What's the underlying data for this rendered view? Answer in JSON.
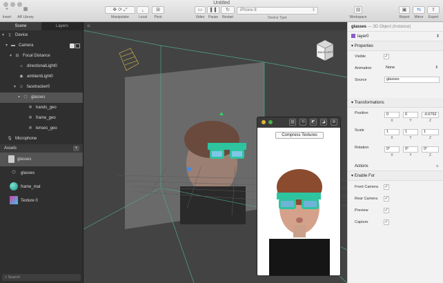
{
  "window": {
    "title": "Untitled"
  },
  "toolbar": {
    "insert": "Insert",
    "all_library": "AR Library",
    "manipulator": "Manipulator",
    "local": "Local",
    "pivot": "Pivot",
    "video": "Video",
    "pause": "Pause",
    "restart": "Restart",
    "device_value": "iPhone 8",
    "device_label": "Device Type",
    "workspace": "Workspace",
    "report": "Report",
    "mirror": "Mirror",
    "export": "Export"
  },
  "scene_panel": {
    "tabs": [
      "Scene",
      "Layers"
    ],
    "items": [
      {
        "label": "Device",
        "icon": "device-icon"
      },
      {
        "label": "Camera",
        "icon": "camera-icon"
      },
      {
        "label": "Focal Distance",
        "icon": "focal-distance-icon"
      },
      {
        "label": "directionalLight0",
        "icon": "light-icon"
      },
      {
        "label": "ambientLight0",
        "icon": "light-icon"
      },
      {
        "label": "facetracker0",
        "icon": "facetracker-icon"
      },
      {
        "label": "glasses",
        "icon": "object-icon"
      },
      {
        "label": "hands_geo",
        "icon": "gear-icon"
      },
      {
        "label": "frame_geo",
        "icon": "gear-icon"
      },
      {
        "label": "lenses_geo",
        "icon": "gear-icon"
      },
      {
        "label": "Microphone",
        "icon": "microphone-icon"
      }
    ],
    "assets_title": "Assets",
    "assets": [
      {
        "label": "glasses",
        "icon": "folder-icon"
      },
      {
        "label": "glasses",
        "icon": "object-icon"
      },
      {
        "label": "frame_mat",
        "icon": "material-icon"
      },
      {
        "label": "Texture 0",
        "icon": "texture-icon"
      }
    ],
    "search_placeholder": "Search"
  },
  "preview": {
    "compress_button": "Compress Textures"
  },
  "inspector": {
    "object_name": "glasses",
    "object_type": "— 3D Object (Instance)",
    "layer": "layer0",
    "properties_title": "Properties",
    "visible_label": "Visible",
    "animation_label": "Animation",
    "animation_value": "None",
    "source_label": "Source",
    "source_value": "glasses",
    "transformations_title": "Transformations",
    "position_label": "Position",
    "position": [
      "0",
      "0",
      "-0.6792"
    ],
    "scale_label": "Scale",
    "scale": [
      "1",
      "1",
      "1"
    ],
    "rotation_label": "Rotation",
    "rotation": [
      "0°",
      "0°",
      "0°"
    ],
    "axes": [
      "X",
      "Y",
      "Z"
    ],
    "actions_title": "Actions",
    "enable_for_title": "Enable For",
    "enable_for": [
      "Front Camera",
      "Rear Camera",
      "Preview",
      "Capture"
    ]
  },
  "colors": {
    "accent": "#2ec4a0",
    "selection": "#545454",
    "layer_swatch": "#8a5cc7"
  }
}
